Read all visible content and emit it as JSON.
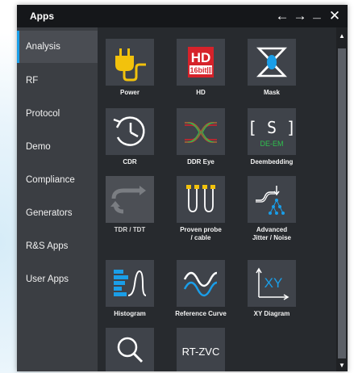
{
  "window": {
    "title": "Apps",
    "controls": [
      "back-arrow-icon",
      "forward-arrow-icon",
      "minimize-icon",
      "close-icon"
    ],
    "glyphs": {
      "back": "←",
      "forward": "→",
      "minimize": "_",
      "close": "✕"
    }
  },
  "sidebar": {
    "items": [
      {
        "label": "Analysis",
        "active": true
      },
      {
        "label": "RF"
      },
      {
        "label": "Protocol"
      },
      {
        "label": "Demo"
      },
      {
        "label": "Compliance"
      },
      {
        "label": "Generators"
      },
      {
        "label": "R&S Apps"
      },
      {
        "label": "User Apps"
      }
    ]
  },
  "apps": [
    {
      "label": "Power",
      "icon": "power-plug-icon"
    },
    {
      "label": "HD",
      "icon": "hd-16bit-icon",
      "icon_text": "HD",
      "icon_subtext": "16bit"
    },
    {
      "label": "Mask",
      "icon": "mask-icon"
    },
    {
      "label": "CDR",
      "icon": "clock-recovery-icon"
    },
    {
      "label": "DDR Eye",
      "icon": "eye-diagram-icon"
    },
    {
      "label": "Deembedding",
      "icon": "deembedding-icon",
      "icon_text": "[ S ]",
      "icon_subtext": "DE-EM"
    },
    {
      "label": "TDR / TDT",
      "icon": "tdr-icon",
      "disabled": true
    },
    {
      "label": "Proven probe / cable",
      "icon": "probe-cable-icon",
      "label_line1": "Proven probe",
      "label_line2": "/ cable"
    },
    {
      "label": "Advanced Jitter / Noise",
      "icon": "jitter-noise-icon",
      "label_line1": "Advanced",
      "label_line2": "Jitter / Noise"
    },
    {
      "label": "Histogram",
      "icon": "histogram-icon"
    },
    {
      "label": "Reference Curve",
      "icon": "reference-curve-icon"
    },
    {
      "label": "XY Diagram",
      "icon": "xy-diagram-icon",
      "icon_text": "XY"
    },
    {
      "label": "",
      "icon": "search-icon"
    },
    {
      "label": "",
      "icon": "rt-zvc-icon",
      "icon_text": "RT-ZVC"
    }
  ],
  "scrollbar": {
    "up": "▲",
    "down": "▼"
  },
  "colors": {
    "accent_blue": "#1a9ee8",
    "hd_red": "#d6222a",
    "power_yellow": "#f2c20c",
    "deem_green": "#2fc04e"
  }
}
